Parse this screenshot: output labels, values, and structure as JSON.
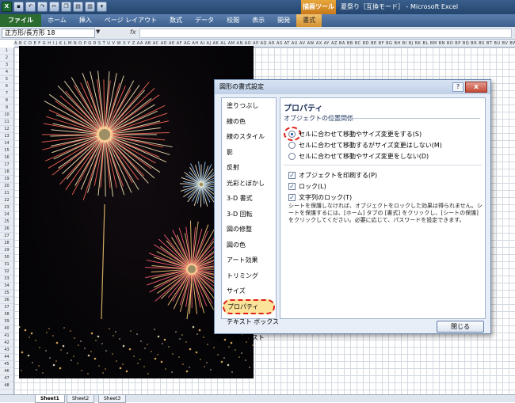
{
  "titlebar": {
    "app_icon": "X",
    "context_tab_label": "描画ツール",
    "window_title": "夏祭り［互換モード］ - Microsoft Excel"
  },
  "ribbon": {
    "tabs": [
      "ファイル",
      "ホーム",
      "挿入",
      "ページ レイアウト",
      "数式",
      "データ",
      "校閲",
      "表示",
      "開発",
      "書式"
    ]
  },
  "formula_bar": {
    "name_box_value": "正方形/長方形 18",
    "fx_label": "fx",
    "formula_value": ""
  },
  "sheet": {
    "column_headers": "A B C D E F G H I J K L M N O P Q R S T U V W X Y Z AA AB AC AD AE AF AG AH AI AJ AK AL AM AN AO AP AQ AR AS AT AU AV AW AX AY AZ BA BB BC BD BE BF BG BH BI BJ BK BL BM BN BO BP BQ BR BS BT BU BV BW BX BY BZ CA CB CC CD CE",
    "row_count": 48,
    "tabs": [
      "Sheet1",
      "Sheet2",
      "Sheet3"
    ]
  },
  "dialog": {
    "title": "図形の書式設定",
    "help_label": "?",
    "close_x": "x",
    "nav_items": [
      "塗りつぶし",
      "線の色",
      "線のスタイル",
      "影",
      "反射",
      "光彩とぼかし",
      "3-D 書式",
      "3-D 回転",
      "図の修整",
      "図の色",
      "アート効果",
      "トリミング",
      "サイズ",
      "プロパティ",
      "テキスト ボックス",
      "代替テキスト"
    ],
    "selected_nav_index": 13,
    "panel": {
      "heading": "プロパティ",
      "section_label": "オブジェクトの位置関係",
      "radio_options": [
        "セルに合わせて移動やサイズ変更をする(S)",
        "セルに合わせて移動するがサイズ変更はしない(M)",
        "セルに合わせて移動やサイズ変更をしない(D)"
      ],
      "selected_radio_index": 0,
      "checkbox_options": [
        "オブジェクトを印刷する(P)",
        "ロック(L)",
        "文字列のロック(T)"
      ],
      "checkbox_states": [
        true,
        true,
        true
      ],
      "note": "シートを保護しなければ、オブジェクトをロックした効果は得られません。シートを保護するには、[ホーム] タブの [書式] をクリックし、[シートの保護] をクリックしてください。必要に応じて、パスワードを設定できます。"
    },
    "close_button_label": "閉じる"
  },
  "colors": {
    "ribbon_blue": "#3c5f8d",
    "file_tab_green": "#2c6b2f",
    "context_orange": "#d49031",
    "highlight_red": "#e0201b",
    "selection_yellow": "#fbe39a"
  },
  "icons": {
    "qat": [
      "excel-icon",
      "save-icon",
      "undo-icon",
      "redo-icon",
      "cut-icon",
      "copy-icon",
      "paste-icon",
      "chart-icon",
      "dropdown-icon"
    ]
  }
}
